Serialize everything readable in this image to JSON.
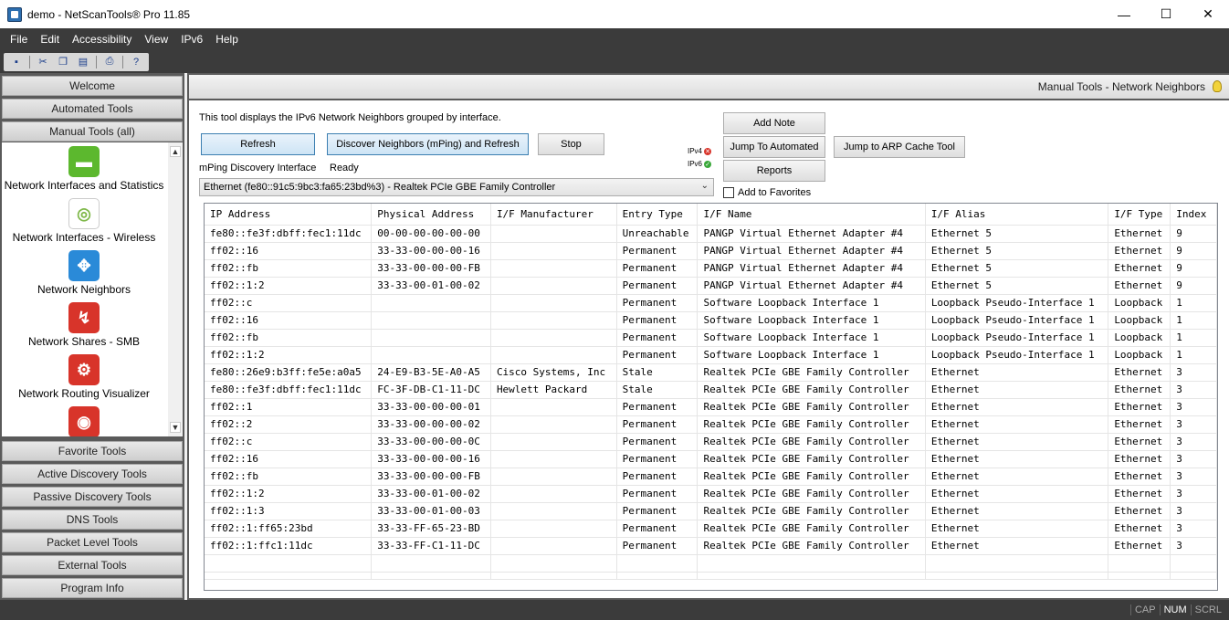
{
  "window": {
    "title": "demo - NetScanTools® Pro 11.85",
    "minimize": "—",
    "maximize": "☐",
    "close": "✕"
  },
  "menu": [
    "File",
    "Edit",
    "Accessibility",
    "View",
    "IPv6",
    "Help"
  ],
  "toolbar_icons": [
    "save-icon",
    "cut-icon",
    "copy-icon",
    "paste-icon",
    "print-icon",
    "help-icon"
  ],
  "nav": {
    "top_sections": [
      "Welcome",
      "Automated Tools",
      "Manual Tools (all)"
    ],
    "tools": [
      {
        "label": "Network Interfaces and Statistics",
        "icon": "network-interfaces-icon",
        "color": "#5cb82e"
      },
      {
        "label": "Network Interfaces - Wireless",
        "icon": "wireless-icon",
        "color": "#7fb84a"
      },
      {
        "label": "Network Neighbors",
        "icon": "network-neighbors-icon",
        "color": "#2a8ad8"
      },
      {
        "label": "Network Shares - SMB",
        "icon": "shares-icon",
        "color": "#d8342a"
      },
      {
        "label": "Network Routing Visualizer",
        "icon": "routing-icon",
        "color": "#d8342a"
      },
      {
        "label": "",
        "icon": "target-icon",
        "color": "#d8342a"
      }
    ],
    "bottom_sections": [
      "Favorite Tools",
      "Active Discovery Tools",
      "Passive Discovery Tools",
      "DNS Tools",
      "Packet Level Tools",
      "External Tools",
      "Program Info"
    ]
  },
  "header": {
    "breadcrumb": "Manual Tools - Network Neighbors"
  },
  "panel": {
    "description": "This tool displays the IPv6 Network Neighbors grouped by interface.",
    "refresh": "Refresh",
    "discover": "Discover Neighbors (mPing) and Refresh",
    "stop": "Stop",
    "add_note": "Add Note",
    "jump_automated": "Jump To Automated",
    "reports": "Reports",
    "jump_arp": "Jump to ARP Cache Tool",
    "ipv4_label": "IPv4",
    "ipv6_label": "IPv6",
    "mping_label": "mPing Discovery Interface",
    "status": "Ready",
    "interface": "Ethernet (fe80::91c5:9bc3:fa65:23bd%3) - Realtek PCIe GBE Family Controller",
    "add_favorites": "Add to Favorites"
  },
  "table": {
    "columns": [
      "IP Address",
      "Physical Address",
      "I/F Manufacturer",
      "Entry Type",
      "I/F Name",
      "I/F Alias",
      "I/F Type",
      "Index"
    ],
    "rows": [
      [
        "fe80::fe3f:dbff:fec1:11dc",
        "00-00-00-00-00-00",
        "",
        "Unreachable",
        "PANGP Virtual Ethernet Adapter #4",
        "Ethernet 5",
        "Ethernet",
        "9"
      ],
      [
        "ff02::16",
        "33-33-00-00-00-16",
        "",
        "Permanent",
        "PANGP Virtual Ethernet Adapter #4",
        "Ethernet 5",
        "Ethernet",
        "9"
      ],
      [
        "ff02::fb",
        "33-33-00-00-00-FB",
        "",
        "Permanent",
        "PANGP Virtual Ethernet Adapter #4",
        "Ethernet 5",
        "Ethernet",
        "9"
      ],
      [
        "ff02::1:2",
        "33-33-00-01-00-02",
        "",
        "Permanent",
        "PANGP Virtual Ethernet Adapter #4",
        "Ethernet 5",
        "Ethernet",
        "9"
      ],
      [
        "ff02::c",
        "",
        "",
        "Permanent",
        "Software Loopback Interface 1",
        "Loopback Pseudo-Interface 1",
        "Loopback",
        "1"
      ],
      [
        "ff02::16",
        "",
        "",
        "Permanent",
        "Software Loopback Interface 1",
        "Loopback Pseudo-Interface 1",
        "Loopback",
        "1"
      ],
      [
        "ff02::fb",
        "",
        "",
        "Permanent",
        "Software Loopback Interface 1",
        "Loopback Pseudo-Interface 1",
        "Loopback",
        "1"
      ],
      [
        "ff02::1:2",
        "",
        "",
        "Permanent",
        "Software Loopback Interface 1",
        "Loopback Pseudo-Interface 1",
        "Loopback",
        "1"
      ],
      [
        "fe80::26e9:b3ff:fe5e:a0a5",
        "24-E9-B3-5E-A0-A5",
        "Cisco Systems, Inc",
        "Stale",
        "Realtek PCIe GBE Family Controller",
        "Ethernet",
        "Ethernet",
        "3"
      ],
      [
        "fe80::fe3f:dbff:fec1:11dc",
        "FC-3F-DB-C1-11-DC",
        "Hewlett Packard",
        "Stale",
        "Realtek PCIe GBE Family Controller",
        "Ethernet",
        "Ethernet",
        "3"
      ],
      [
        "ff02::1",
        "33-33-00-00-00-01",
        "",
        "Permanent",
        "Realtek PCIe GBE Family Controller",
        "Ethernet",
        "Ethernet",
        "3"
      ],
      [
        "ff02::2",
        "33-33-00-00-00-02",
        "",
        "Permanent",
        "Realtek PCIe GBE Family Controller",
        "Ethernet",
        "Ethernet",
        "3"
      ],
      [
        "ff02::c",
        "33-33-00-00-00-0C",
        "",
        "Permanent",
        "Realtek PCIe GBE Family Controller",
        "Ethernet",
        "Ethernet",
        "3"
      ],
      [
        "ff02::16",
        "33-33-00-00-00-16",
        "",
        "Permanent",
        "Realtek PCIe GBE Family Controller",
        "Ethernet",
        "Ethernet",
        "3"
      ],
      [
        "ff02::fb",
        "33-33-00-00-00-FB",
        "",
        "Permanent",
        "Realtek PCIe GBE Family Controller",
        "Ethernet",
        "Ethernet",
        "3"
      ],
      [
        "ff02::1:2",
        "33-33-00-01-00-02",
        "",
        "Permanent",
        "Realtek PCIe GBE Family Controller",
        "Ethernet",
        "Ethernet",
        "3"
      ],
      [
        "ff02::1:3",
        "33-33-00-01-00-03",
        "",
        "Permanent",
        "Realtek PCIe GBE Family Controller",
        "Ethernet",
        "Ethernet",
        "3"
      ],
      [
        "ff02::1:ff65:23bd",
        "33-33-FF-65-23-BD",
        "",
        "Permanent",
        "Realtek PCIe GBE Family Controller",
        "Ethernet",
        "Ethernet",
        "3"
      ],
      [
        "ff02::1:ffc1:11dc",
        "33-33-FF-C1-11-DC",
        "",
        "Permanent",
        "Realtek PCIe GBE Family Controller",
        "Ethernet",
        "Ethernet",
        "3"
      ]
    ]
  },
  "statusbar": [
    {
      "label": "CAP",
      "active": false
    },
    {
      "label": "NUM",
      "active": true
    },
    {
      "label": "SCRL",
      "active": false
    }
  ]
}
